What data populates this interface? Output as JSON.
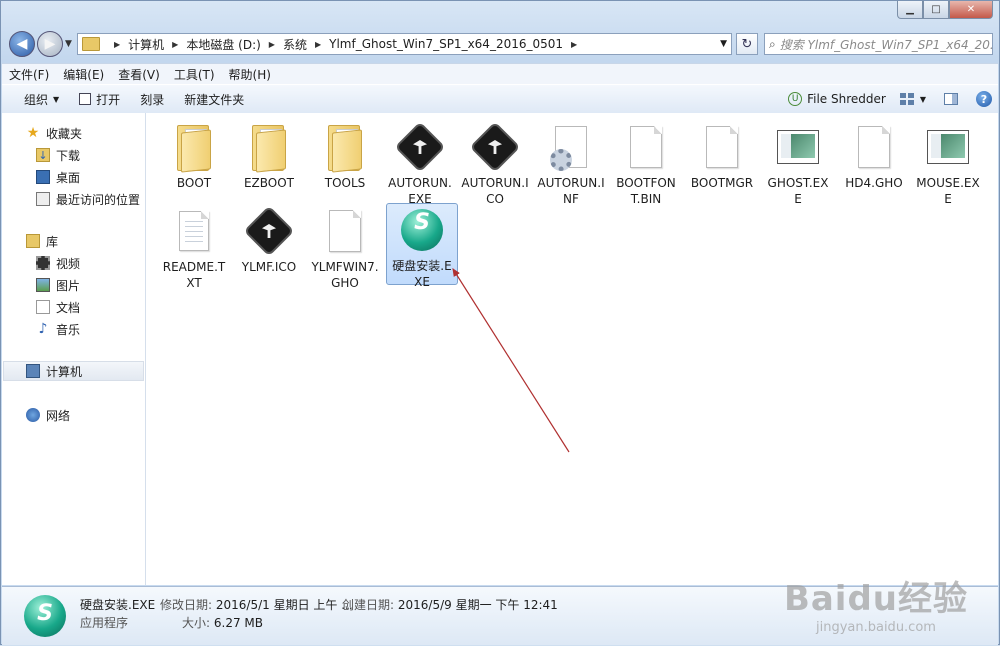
{
  "address": {
    "crumbs": [
      "计算机",
      "本地磁盘 (D:)",
      "系统",
      "Ylmf_Ghost_Win7_SP1_x64_2016_0501"
    ]
  },
  "search": {
    "placeholder": "搜索 Ylmf_Ghost_Win7_SP1_x64_20..."
  },
  "menubar": [
    "文件(F)",
    "编辑(E)",
    "查看(V)",
    "工具(T)",
    "帮助(H)"
  ],
  "toolbar": {
    "organize": "组织",
    "open": "打开",
    "burn": "刻录",
    "new_folder": "新建文件夹",
    "file_shredder": "File Shredder"
  },
  "navpane": {
    "favorites": "收藏夹",
    "downloads": "下载",
    "desktop": "桌面",
    "recent": "最近访问的位置",
    "libraries": "库",
    "videos": "视频",
    "pictures": "图片",
    "documents": "文档",
    "music": "音乐",
    "computer": "计算机",
    "network": "网络"
  },
  "files": [
    {
      "name": "BOOT",
      "kind": "folder"
    },
    {
      "name": "EZBOOT",
      "kind": "folder"
    },
    {
      "name": "TOOLS",
      "kind": "folder"
    },
    {
      "name": "AUTORUN.EXE",
      "kind": "ylmf"
    },
    {
      "name": "AUTORUN.ICO",
      "kind": "ylmf"
    },
    {
      "name": "AUTORUN.INF",
      "kind": "config"
    },
    {
      "name": "BOOTFONT.BIN",
      "kind": "blank"
    },
    {
      "name": "BOOTMGR",
      "kind": "blank"
    },
    {
      "name": "GHOST.EXE",
      "kind": "window"
    },
    {
      "name": "HD4.GHO",
      "kind": "blank"
    },
    {
      "name": "MOUSE.EXE",
      "kind": "window"
    },
    {
      "name": "README.TXT",
      "kind": "text"
    },
    {
      "name": "YLMF.ICO",
      "kind": "ylmf"
    },
    {
      "name": "YLMFWIN7.GHO",
      "kind": "blank"
    },
    {
      "name": "硬盘安装.EXE",
      "kind": "installer",
      "selected": true
    }
  ],
  "details": {
    "name": "硬盘安装.EXE",
    "type": "应用程序",
    "modified_label": "修改日期:",
    "modified_value": "2016/5/1 星期日 上午 ...",
    "created_label": "创建日期:",
    "created_value": "2016/5/9 星期一 下午 12:41",
    "size_label": "大小:",
    "size_value": "6.27 MB"
  },
  "watermark": {
    "line1": "Baidu经验",
    "line2": "jingyan.baidu.com"
  },
  "colors": {
    "selection": "#c1dbfc",
    "arrow": "#b03030",
    "window_frame": "#c3d7ee"
  }
}
